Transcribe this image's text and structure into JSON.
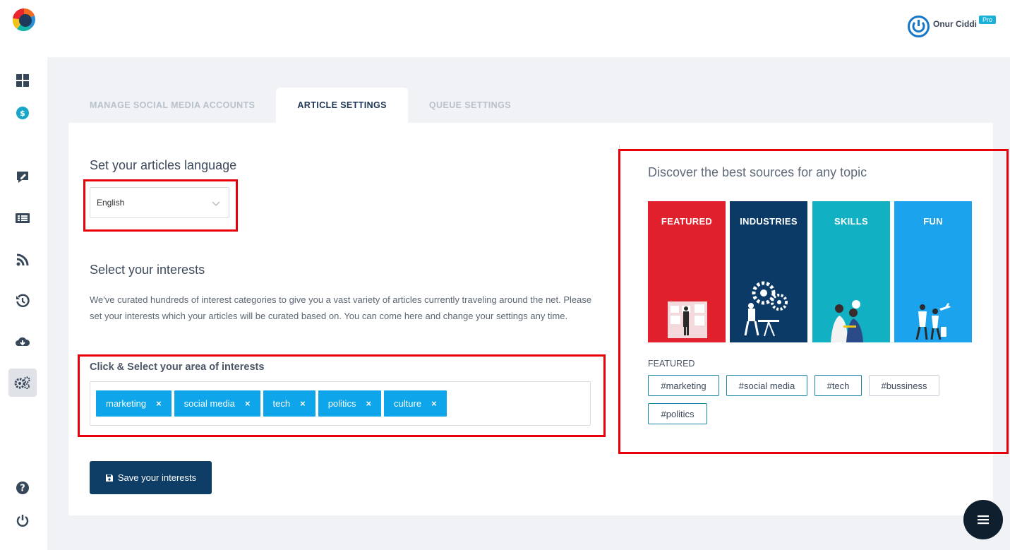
{
  "app": {
    "brand_colors": {
      "primary": "#0e3e66",
      "accent": "#0ea5ea",
      "highlight": "#e8000b"
    }
  },
  "sidebar": {
    "items": [
      {
        "name": "dashboard",
        "icon": "grid-icon"
      },
      {
        "name": "billing",
        "icon": "dollar-icon"
      },
      {
        "name": "compose",
        "icon": "edit-icon"
      },
      {
        "name": "articles",
        "icon": "list-icon"
      },
      {
        "name": "rss",
        "icon": "rss-icon"
      },
      {
        "name": "history",
        "icon": "history-icon"
      },
      {
        "name": "download",
        "icon": "cloud-download-icon"
      },
      {
        "name": "settings",
        "icon": "gears-icon",
        "active": true
      },
      {
        "name": "help",
        "icon": "question-icon"
      },
      {
        "name": "logout",
        "icon": "power-icon"
      }
    ]
  },
  "header": {
    "user_name": "Onur Ciddi",
    "badge": "Pro"
  },
  "tabs": [
    {
      "label": "MANAGE SOCIAL MEDIA ACCOUNTS",
      "active": false
    },
    {
      "label": "ARTICLE SETTINGS",
      "active": true
    },
    {
      "label": "QUEUE SETTINGS",
      "active": false
    }
  ],
  "language": {
    "heading": "Set your articles language",
    "selected": "English"
  },
  "interests": {
    "heading": "Select your interests",
    "description": "We've curated hundreds of interest categories to give you a vast variety of articles currently traveling around the net. Please set your interests which your articles will be curated based on. You can come here and change your settings any time.",
    "select_label": "Click & Select your area of interests",
    "tags": [
      "marketing",
      "social media",
      "tech",
      "politics",
      "culture"
    ],
    "remove_glyph": "×",
    "save_label": "Save your interests"
  },
  "discover": {
    "heading": "Discover the best sources for any topic",
    "categories": [
      {
        "label": "FEATURED",
        "color": "#e0202c"
      },
      {
        "label": "INDUSTRIES",
        "color": "#0c3a66"
      },
      {
        "label": "SKILLS",
        "color": "#11b0c3"
      },
      {
        "label": "FUN",
        "color": "#1ca3ee"
      }
    ],
    "selected_label": "FEATURED",
    "hashtags": [
      {
        "text": "#marketing",
        "selected": true
      },
      {
        "text": "#social media",
        "selected": true
      },
      {
        "text": "#tech",
        "selected": true
      },
      {
        "text": "#bussiness",
        "selected": false
      },
      {
        "text": "#politics",
        "selected": true
      }
    ]
  }
}
